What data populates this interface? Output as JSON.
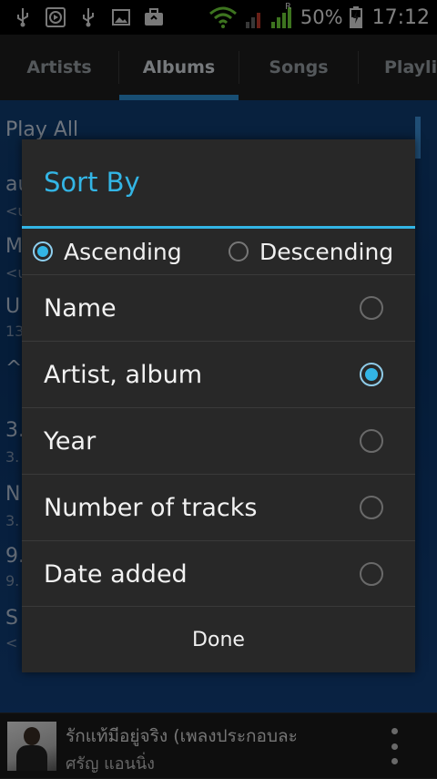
{
  "status_bar": {
    "icons": [
      "usb-icon",
      "media-icon",
      "usb-icon",
      "image-icon",
      "briefcase-icon",
      "wifi-icon",
      "signal-icon"
    ],
    "roaming_label": "R",
    "battery": "50%",
    "time": "17:12"
  },
  "tabs": [
    {
      "label": "Artists",
      "active": false
    },
    {
      "label": "Albums",
      "active": true
    },
    {
      "label": "Songs",
      "active": false
    },
    {
      "label": "Playlis",
      "active": false
    }
  ],
  "background_list": {
    "play_all": "Play All",
    "row_fragments": [
      "au",
      "<u",
      "M",
      "<u",
      "U",
      "13",
      "^",
      "3.",
      "3.",
      "N",
      "3.",
      "9.",
      "9.",
      "S",
      "<"
    ]
  },
  "dialog": {
    "title": "Sort By",
    "order": {
      "ascending": "Ascending",
      "descending": "Descending",
      "selected": "ascending"
    },
    "options": [
      {
        "label": "Name",
        "selected": false
      },
      {
        "label": "Artist, album",
        "selected": true
      },
      {
        "label": "Year",
        "selected": false
      },
      {
        "label": "Number of tracks",
        "selected": false
      },
      {
        "label": "Date added",
        "selected": false
      }
    ],
    "done_label": "Done"
  },
  "now_playing": {
    "title": "รักแท้มีอยู่จริง (เพลงประกอบละ",
    "artist": "ศรัญ แอนนิ่ง"
  },
  "colors": {
    "accent": "#33b5e5",
    "dialog_bg": "#282828",
    "tab_indicator": "#2d8fd1"
  }
}
